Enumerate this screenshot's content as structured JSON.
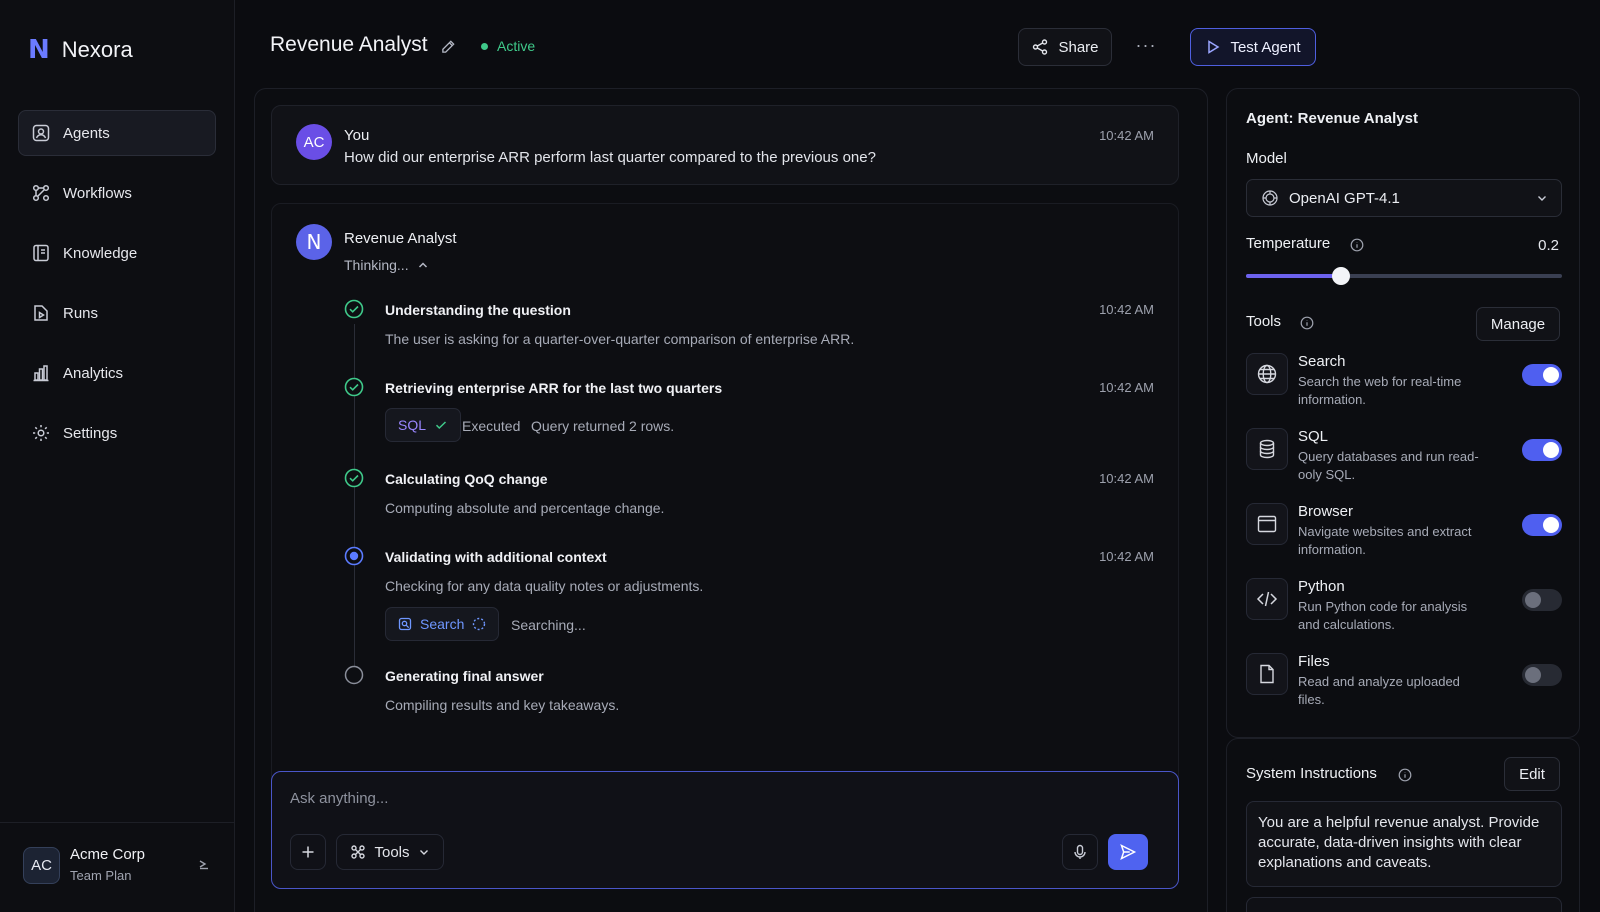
{
  "brand": {
    "name": "Nexora",
    "logo_letter": "N"
  },
  "sidebar": {
    "items": [
      {
        "label": "Agents",
        "icon": "agents-icon",
        "active": true
      },
      {
        "label": "Workflows",
        "icon": "workflows-icon",
        "active": false
      },
      {
        "label": "Knowledge",
        "icon": "knowledge-icon",
        "active": false
      },
      {
        "label": "Runs",
        "icon": "runs-icon",
        "active": false
      },
      {
        "label": "Analytics",
        "icon": "analytics-icon",
        "active": false
      },
      {
        "label": "Settings",
        "icon": "settings-icon",
        "active": false
      }
    ],
    "account": {
      "initials": "AC",
      "name": "Acme Corp",
      "plan": "Team Plan"
    }
  },
  "header": {
    "title": "Revenue Analyst",
    "status": "Active",
    "share_label": "Share",
    "more_label": "···",
    "test_label": "Test Agent"
  },
  "chat": {
    "user_message": {
      "initials": "AC",
      "author": "You",
      "text": "How did our enterprise ARR perform last quarter compared to the previous one?",
      "time": "10:42 AM"
    },
    "agent_message": {
      "initial": "N",
      "author": "Revenue Analyst",
      "thinking_label": "Thinking...",
      "steps": [
        {
          "title": "Understanding the question",
          "desc": "The user is asking for a quarter-over-quarter comparison of enterprise ARR.",
          "time": "10:42 AM",
          "state": "done"
        },
        {
          "title": "Retrieving enterprise ARR for the last two quarters",
          "tool": "SQL",
          "tool_status": "Executed",
          "tool_note": "Query returned 2 rows.",
          "time": "10:42 AM",
          "state": "done"
        },
        {
          "title": "Calculating QoQ change",
          "desc": "Computing absolute and percentage change.",
          "time": "10:42 AM",
          "state": "done"
        },
        {
          "title": "Validating with additional context",
          "desc": "Checking for any data quality notes or adjustments.",
          "tool": "Search",
          "tool_note": "Searching...",
          "time": "10:42 AM",
          "state": "active"
        },
        {
          "title": "Generating final answer",
          "desc": "Compiling results and key takeaways.",
          "state": "pending"
        }
      ]
    },
    "input": {
      "placeholder": "Ask anything...",
      "tools_label": "Tools"
    }
  },
  "config": {
    "title": "Agent: Revenue Analyst",
    "model_label": "Model",
    "model_value": "OpenAI GPT-4.1",
    "temperature_label": "Temperature",
    "temperature_value": "0.2",
    "temperature_fraction": 0.3,
    "tools_label": "Tools",
    "manage_label": "Manage",
    "tools": [
      {
        "name": "Search",
        "desc": "Search the web for real-time information.",
        "icon": "globe-icon",
        "enabled": true
      },
      {
        "name": "SQL",
        "desc": "Query databases and run read-ooly SQL.",
        "icon": "database-icon",
        "enabled": true
      },
      {
        "name": "Browser",
        "desc": "Navigate websites and extract information.",
        "icon": "browser-icon",
        "enabled": true
      },
      {
        "name": "Python",
        "desc": "Run Python code for analysis and calculations.",
        "icon": "code-icon",
        "enabled": false
      },
      {
        "name": "Files",
        "desc": "Read and analyze uploaded files.",
        "icon": "file-icon",
        "enabled": false
      }
    ],
    "system_instructions_label": "System Instructions",
    "edit_label": "Edit",
    "system_instructions": "You are a helpful revenue analyst. Provide accurate, data-driven insights with clear explanations and caveats."
  },
  "colors": {
    "accent": "#4f5ff0",
    "success": "#3fc98a",
    "brand": "#6b7bff"
  }
}
